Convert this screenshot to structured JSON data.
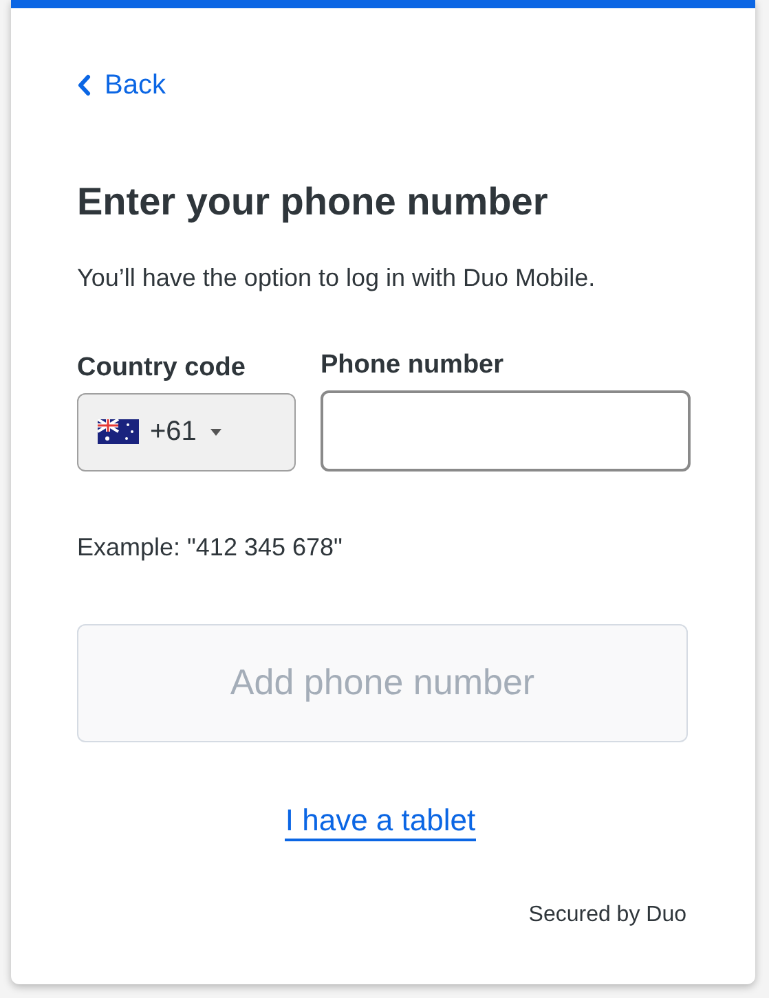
{
  "back_link": {
    "label": "Back"
  },
  "title": "Enter your phone number",
  "subtitle": "You’ll have the option to log in with Duo Mobile.",
  "country_code": {
    "label": "Country code",
    "value": "+61"
  },
  "phone_number": {
    "label": "Phone number"
  },
  "example": "Example: \"412 345 678\"",
  "add_button": {
    "label": "Add phone number",
    "disabled": true
  },
  "tablet_link": "I have a tablet",
  "footer": "Secured by Duo"
}
